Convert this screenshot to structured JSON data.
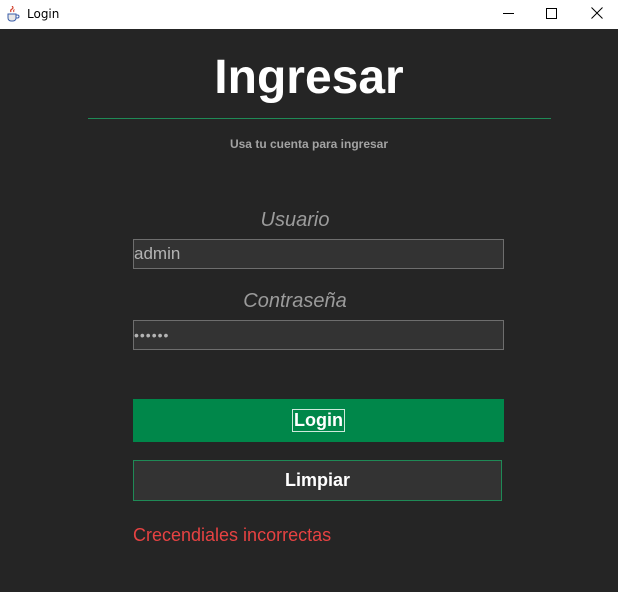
{
  "window": {
    "title": "Login",
    "icon": "java-cup-icon",
    "controls": [
      "minimize-icon",
      "maximize-icon",
      "close-icon"
    ]
  },
  "form": {
    "heading": "Ingresar",
    "subtitle": "Usa tu cuenta para ingresar",
    "username_label": "Usuario",
    "username_value": "admin",
    "password_label": "Contraseña",
    "password_value": "••••••",
    "login_label": "Login",
    "clear_label": "Limpiar",
    "error_message": "Crecendiales incorrectas"
  },
  "colors": {
    "background": "#252525",
    "accent": "#00874a",
    "error": "#e74242"
  }
}
